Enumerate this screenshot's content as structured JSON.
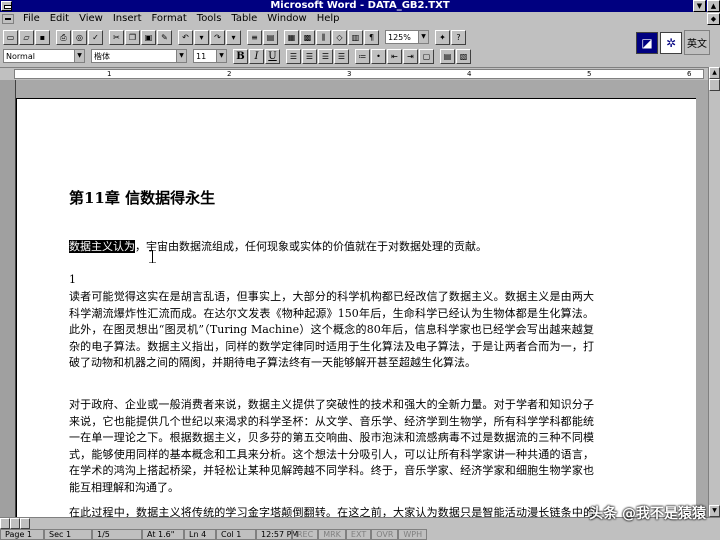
{
  "window": {
    "title": "Microsoft Word - DATA_GB2.TXT"
  },
  "menubar": {
    "items": [
      "File",
      "Edit",
      "View",
      "Insert",
      "Format",
      "Tools",
      "Table",
      "Window",
      "Help"
    ]
  },
  "toolbar": {
    "zoom": "125%",
    "style": "Normal",
    "font": "楷体",
    "size": "11",
    "bold": "B",
    "italic": "I",
    "underline": "U"
  },
  "ime": {
    "label": "英文"
  },
  "ruler": {
    "numbers": [
      "1",
      "2",
      "3",
      "4",
      "5",
      "6"
    ]
  },
  "document": {
    "heading": "第11章 信数据得永生",
    "selected_text": "数据主义认为",
    "first_sentence_rest": "，宇宙由数据流组成，任何现象或实体的价值就在于对数据处理的贡献。",
    "marker": "1",
    "para1": "读者可能觉得这实在是胡言乱语，但事实上，大部分的科学机构都已经改信了数据主义。数据主义是由两大科学潮流爆炸性汇流而成。在达尔文发表《物种起源》150年后，生命科学已经认为生物体都是生化算法。此外，在图灵想出“图灵机”（Turing Machine）这个概念的80年后，信息科学家也已经学会写出越来越复杂的电子算法。数据主义指出，同样的数学定律同时适用于生化算法及电子算法，于是让两者合而为一，打破了动物和机器之间的隔阂，并期待电子算法终有一天能够解开甚至超越生化算法。",
    "para2": "对于政府、企业或一般消费者来说，数据主义提供了突破性的技术和强大的全新力量。对于学者和知识分子来说，它也能提供几个世纪以来渴求的科学圣杯：从文学、音乐学、经济学到生物学，所有科学学科都能统一在单一理论之下。根据数据主义，贝多芬的第五交响曲、股市泡沫和流感病毒不过是数据流的三种不同模式，能够使用同样的基本概念和工具来分析。这个想法十分吸引人，可以让所有科学家讲一种共通的语言，在学术的鸿沟上搭起桥梁，并轻松让某种见解跨越不同学科。终于，音乐学家、经济学家和细胞生物学家也能互相理解和沟通了。",
    "para3": "在此过程中，数据主义将传统的学习金字塔颠倒翻转。在这之前，大家认为数据只是智能活动漫长链条中的第一步。"
  },
  "status": {
    "page": "Page 1",
    "sec": "Sec 1",
    "pages": "1/5",
    "at": "At 1.6\"",
    "ln": "Ln 4",
    "col": "Col 1",
    "time": "12:57 PM",
    "rec": "REC",
    "mrk": "MRK",
    "ext": "EXT",
    "ovr": "OVR",
    "wph": "WPH"
  },
  "watermark": "头条 @我不是猿猿"
}
